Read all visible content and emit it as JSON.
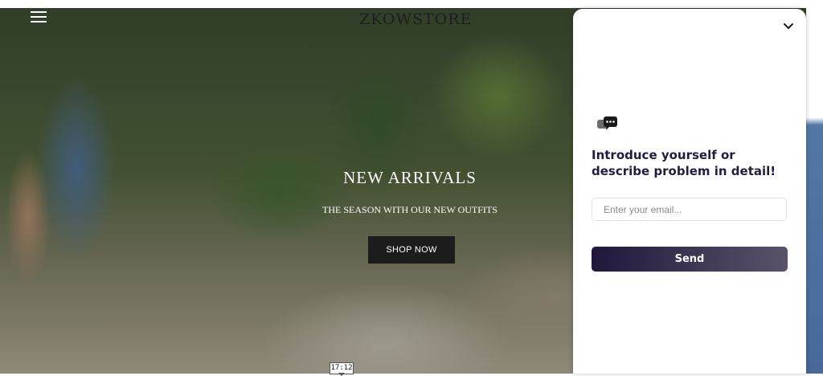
{
  "header": {
    "store_name": "ZKOWSTORE",
    "menu_icon": "hamburger-menu-icon"
  },
  "hero": {
    "title": "NEW ARRIVALS",
    "subtitle": "THE SEASON WITH OUR NEW OUTFITS",
    "cta_label": "SHOP NOW"
  },
  "chat": {
    "collapse_icon": "chevron-down-icon",
    "logo_icon": "chat-bubbles-icon",
    "heading": "Introduce yourself or describe problem in detail!",
    "email_placeholder": "Enter your email...",
    "email_value": "",
    "send_label": "Send",
    "accent_color": "#20173b"
  },
  "overlay": {
    "time_label": "17:12"
  }
}
